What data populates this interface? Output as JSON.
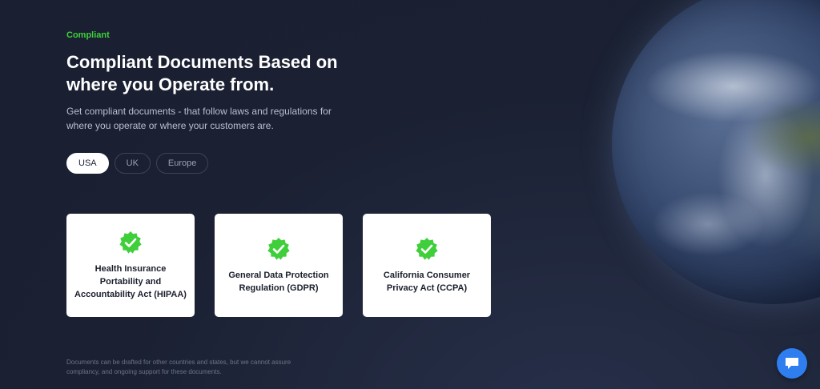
{
  "hero": {
    "eyebrow": "Compliant",
    "title": "Compliant Documents Based on where you Operate from.",
    "subtitle": "Get compliant documents - that follow laws and regulations for where you operate or where your customers are."
  },
  "tabs": [
    {
      "label": "USA",
      "active": true
    },
    {
      "label": "UK",
      "active": false
    },
    {
      "label": "Europe",
      "active": false
    }
  ],
  "cards": [
    {
      "label": "Health Insurance Portability and Accountability Act (HIPAA)",
      "icon": "verified-check-icon"
    },
    {
      "label": "General Data Protection Regulation (GDPR)",
      "icon": "verified-check-icon"
    },
    {
      "label": "California Consumer Privacy Act (CCPA)",
      "icon": "verified-check-icon"
    }
  ],
  "disclaimer": "Documents can be drafted for other countries and states, but we cannot assure compliancy, and ongoing support for these documents.",
  "chat": {
    "icon": "chat-bubble-icon"
  },
  "colors": {
    "accent_green": "#3fcf3a",
    "background": "#1b2133",
    "chat_blue": "#2f7ef0"
  }
}
